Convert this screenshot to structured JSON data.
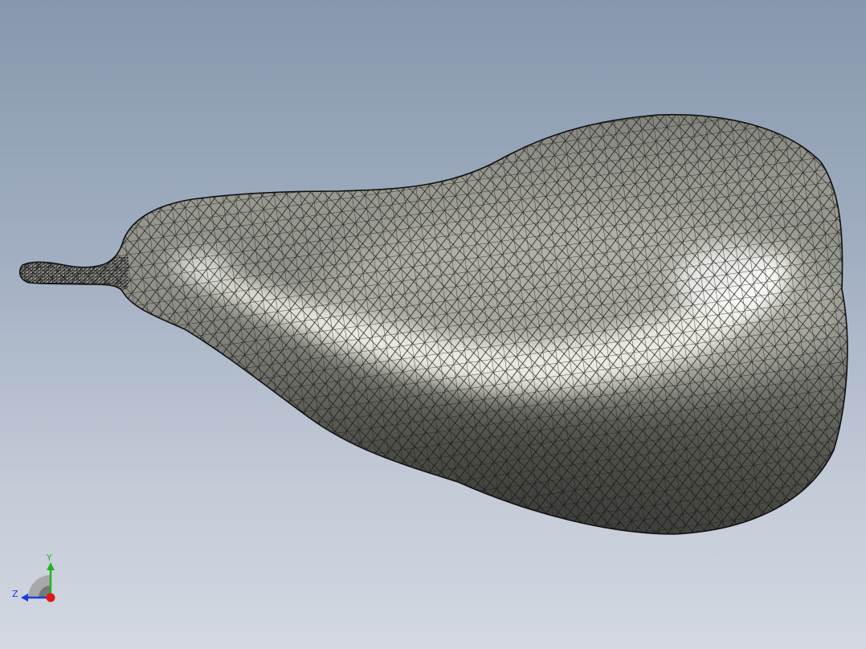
{
  "viewport": {
    "model_type": "mesh-surface",
    "model_shape": "pear",
    "display_style": "shaded-with-edges",
    "background_top_color": "#8797ad",
    "background_bottom_color": "#d3d8e1",
    "model_color": "#8f8f87",
    "model_highlight_color": "#f4f4ea",
    "edge_color": "#141414"
  },
  "triad": {
    "y_label": "Y",
    "z_label": "Z",
    "y_color": "#22b422",
    "z_color": "#1e3cdc",
    "x_color": "#e01818"
  }
}
